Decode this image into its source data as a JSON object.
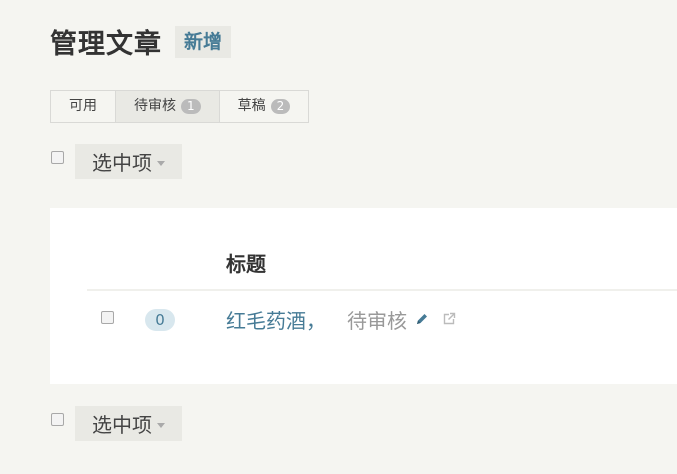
{
  "header": {
    "title": "管理文章",
    "add_label": "新增"
  },
  "tabs": [
    {
      "label": "可用",
      "badge": null,
      "active": false
    },
    {
      "label": "待审核",
      "badge": "1",
      "active": true
    },
    {
      "label": "草稿",
      "badge": "2",
      "active": false
    }
  ],
  "bulk_actions": {
    "label": "选中项"
  },
  "table": {
    "column_title": "标题",
    "rows": [
      {
        "comments": "0",
        "title": "红毛药酒，",
        "status": "待审核"
      }
    ]
  },
  "colors": {
    "accent": "#467b96",
    "background": "#f5f5f1",
    "panel": "#ffffff"
  },
  "icons": [
    "pencil-icon",
    "external-link-icon",
    "caret-down-icon"
  ]
}
